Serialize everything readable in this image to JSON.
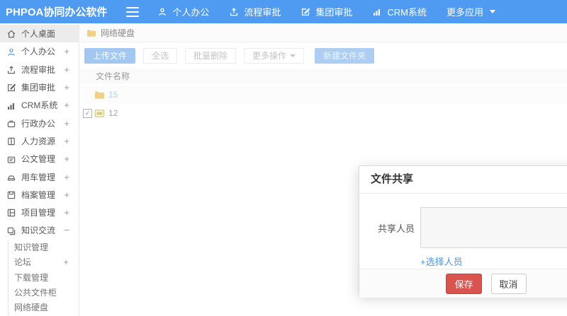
{
  "topbar": {
    "logo": "PHPOA协同办公软件",
    "nav": [
      {
        "label": "个人办公",
        "icon": "person-icon"
      },
      {
        "label": "流程审批",
        "icon": "upload-icon"
      },
      {
        "label": "集团审批",
        "icon": "edit-icon"
      },
      {
        "label": "CRM系统",
        "icon": "chart-icon"
      },
      {
        "label": "更多应用",
        "icon": "caret-down-icon"
      }
    ]
  },
  "sidebar": {
    "items": [
      {
        "label": "个人桌面",
        "icon": "home-icon",
        "expand": "",
        "active": true
      },
      {
        "label": "个人办公",
        "icon": "person-icon",
        "expand": "+"
      },
      {
        "label": "流程审批",
        "icon": "upload-icon",
        "expand": "+"
      },
      {
        "label": "集团审批",
        "icon": "edit-icon",
        "expand": "+"
      },
      {
        "label": "CRM系统",
        "icon": "chart-icon",
        "expand": "+"
      },
      {
        "label": "行政办公",
        "icon": "briefcase-icon",
        "expand": "+"
      },
      {
        "label": "人力资源",
        "icon": "book-icon",
        "expand": "+"
      },
      {
        "label": "公文管理",
        "icon": "document-icon",
        "expand": "+"
      },
      {
        "label": "用车管理",
        "icon": "car-icon",
        "expand": "+"
      },
      {
        "label": "档案管理",
        "icon": "archive-icon",
        "expand": "+"
      },
      {
        "label": "项目管理",
        "icon": "project-icon",
        "expand": "+"
      },
      {
        "label": "知识交流",
        "icon": "chat-icon",
        "expand": "−"
      }
    ],
    "submenu": [
      {
        "label": "知识管理",
        "expand": ""
      },
      {
        "label": "论坛",
        "expand": "+"
      },
      {
        "label": "下载管理",
        "expand": ""
      },
      {
        "label": "公共文件柜",
        "expand": ""
      },
      {
        "label": "网络硬盘",
        "expand": ""
      }
    ]
  },
  "breadcrumb": {
    "label": "网络硬盘",
    "icon": "folder-icon"
  },
  "toolbar": {
    "upload": "上传文件",
    "select_all": "全选",
    "batch_delete": "批量删除",
    "more_actions": "更多操作",
    "new_folder": "新建文件夹"
  },
  "file_table": {
    "header": "文件名称",
    "rows": [
      {
        "name": "15",
        "type": "folder",
        "checked": false
      },
      {
        "name": "12",
        "type": "image-file",
        "checked": true
      }
    ],
    "checkmark": "✓"
  },
  "modal": {
    "title": "文件共享",
    "share_label": "共享人员",
    "share_value": "",
    "choose_link": "+选择人员",
    "save": "保存",
    "cancel": "取消"
  },
  "colors": {
    "topbar_blue": "#4f9bf2",
    "primary_button_blue": "#a2c7f1",
    "save_red": "#d9534f",
    "folder_yellow": "#f2cf87",
    "link_blue": "#4796ea",
    "active_item_gray": "#ececec"
  }
}
